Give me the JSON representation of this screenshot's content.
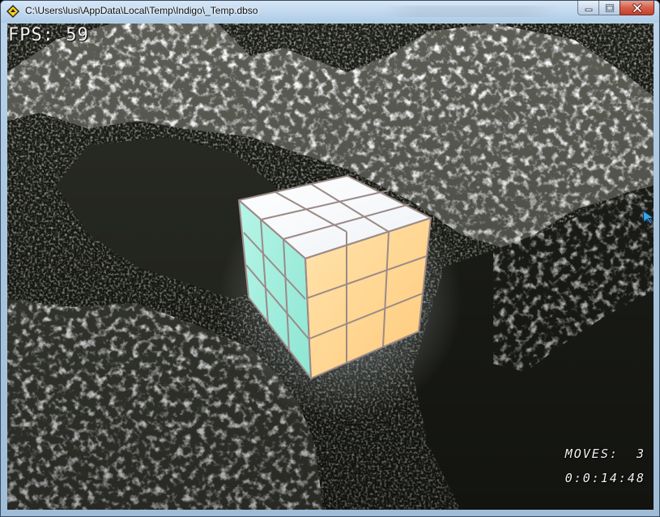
{
  "window": {
    "title": "C:\\Users\\lusi\\AppData\\Local\\Temp\\Indigo\\_Temp.dbso",
    "icon": "dbpro-app-icon",
    "controls": [
      "minimize-icon",
      "maximize-icon",
      "close-icon"
    ]
  },
  "hud": {
    "fps": "FPS: 59",
    "moves": "MOVES:  3",
    "timer": "0:0:14:48"
  },
  "scene": {
    "object": "rubiks-cube",
    "faces": {
      "top": "#f7f9fb",
      "left": "#9ff0df",
      "right": "#ffd89a"
    },
    "background": "snowy-mountain-terrain"
  },
  "colors": {
    "hud_text": "#f2f2f2",
    "close_button": "#c6402a",
    "title_bar": "#c2d8ee"
  }
}
